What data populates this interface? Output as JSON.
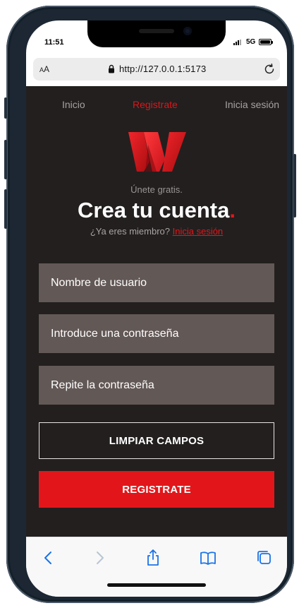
{
  "status_bar": {
    "time": "11:51",
    "network": "5G"
  },
  "browser": {
    "text_size_label": "A",
    "text_size_label_large": "A",
    "url": "http://127.0.0.1:5173"
  },
  "nav": {
    "items": [
      {
        "label": "Inicio",
        "active": false
      },
      {
        "label": "Registrate",
        "active": true
      },
      {
        "label": "Inicia sesión",
        "active": false
      }
    ]
  },
  "hero": {
    "subtitle": "Únete gratis.",
    "title": "Crea tu cuenta",
    "title_dot": ".",
    "member_text": "¿Ya eres miembro?",
    "member_link": "Inicia sesión"
  },
  "form": {
    "username_placeholder": "Nombre de usuario",
    "password_placeholder": "Introduce una contraseña",
    "repeat_password_placeholder": "Repite la contraseña",
    "clear_label": "LIMPIAR CAMPOS",
    "submit_label": "REGISTRATE"
  },
  "colors": {
    "background": "#231f1f",
    "accent": "#e2161a",
    "field_bg": "#625856",
    "nav_inactive": "#a7a2a2"
  },
  "toolbar": {
    "icons": [
      "back-icon",
      "forward-icon",
      "share-icon",
      "bookmarks-icon",
      "tabs-icon"
    ]
  }
}
